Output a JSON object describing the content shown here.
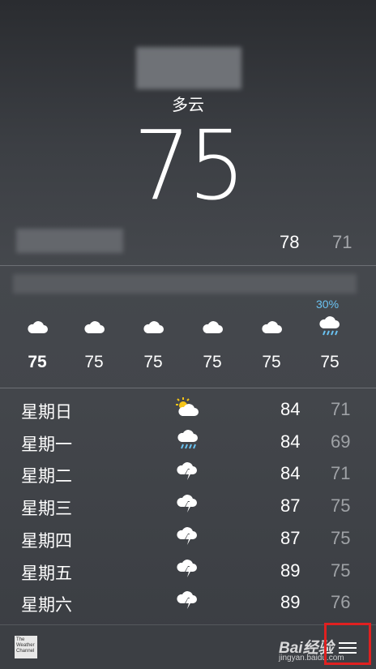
{
  "current": {
    "condition": "多云",
    "temperature": "75"
  },
  "today": {
    "high": "78",
    "low": "71"
  },
  "hourly": {
    "precip_label": "30%",
    "items": [
      {
        "icon": "cloud-icon",
        "temp": "75"
      },
      {
        "icon": "cloud-icon",
        "temp": "75"
      },
      {
        "icon": "cloud-icon",
        "temp": "75"
      },
      {
        "icon": "cloud-icon",
        "temp": "75"
      },
      {
        "icon": "cloud-icon",
        "temp": "75"
      },
      {
        "icon": "cloud-rain-icon",
        "temp": "75"
      }
    ]
  },
  "daily": [
    {
      "day": "星期日",
      "icon": "partly-sunny-icon",
      "high": "84",
      "low": "71"
    },
    {
      "day": "星期一",
      "icon": "cloud-rain-icon",
      "high": "84",
      "low": "69"
    },
    {
      "day": "星期二",
      "icon": "thunderstorm-icon",
      "high": "84",
      "low": "71"
    },
    {
      "day": "星期三",
      "icon": "thunderstorm-icon",
      "high": "87",
      "low": "75"
    },
    {
      "day": "星期四",
      "icon": "thunderstorm-icon",
      "high": "87",
      "low": "75"
    },
    {
      "day": "星期五",
      "icon": "thunderstorm-icon",
      "high": "89",
      "low": "75"
    },
    {
      "day": "星期六",
      "icon": "thunderstorm-icon",
      "high": "89",
      "low": "76"
    }
  ],
  "footer": {
    "logo_text": "The Weather Channel"
  },
  "watermark": {
    "line1": "Bai经验",
    "line2": "jingyan.baidu.com"
  },
  "colors": {
    "precip": "#6ac3f2",
    "highlight": "#e02020"
  }
}
